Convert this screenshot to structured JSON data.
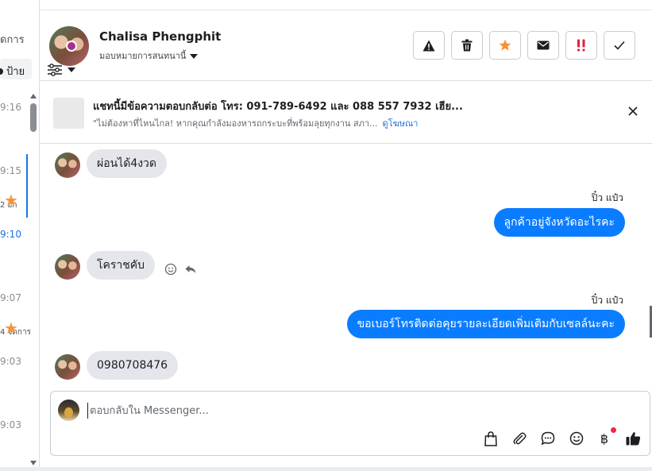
{
  "left_list": {
    "header_partial": "ัดการ",
    "tag_partial": "ป้าย",
    "times": [
      "9:16",
      "9:15",
      "9:10",
      "9:07",
      "9:03",
      "9:03"
    ],
    "snippets": [
      "2 ยก",
      "4 จัดการ"
    ]
  },
  "header": {
    "contact_name": "Chalisa Phengphit",
    "assign_label": "มอบหมายการสนทนานี้",
    "buttons": [
      {
        "name": "spam-button",
        "icon": "warning-icon"
      },
      {
        "name": "delete-button",
        "icon": "trash-icon"
      },
      {
        "name": "star-button",
        "icon": "star-icon"
      },
      {
        "name": "mark-unread-button",
        "icon": "envelope-icon"
      },
      {
        "name": "follow-up-button",
        "icon": "follow-up-icon"
      },
      {
        "name": "mark-done-button",
        "icon": "check-icon"
      }
    ]
  },
  "ad_banner": {
    "title": "แชทนี้มีข้อความตอบกลับต่อ โทร: 091-789-6492 และ 088 557 7932 เฮีย...",
    "subtitle": "\"ไม่ต้องหาที่ไหนไกล! หากคุณกำลังมองหารถกระบะที่พร้อมลุยทุกงาน สภา...",
    "link": "ดูโฆษณา"
  },
  "messages": [
    {
      "direction": "in",
      "text": "ผ่อนได้4งวด"
    },
    {
      "direction": "out",
      "sender": "ปิ๋ว แป๋ว",
      "text": "ลูกค้าอยู่จังหวัดอะไรคะ"
    },
    {
      "direction": "in",
      "text": "โคราชคับ"
    },
    {
      "direction": "out",
      "sender": "ปิ๋ว แป๋ว",
      "text": "ขอเบอร์โทรติดต่อคุยรายละเอียดเพิ่มเติมกับเซลล์นะคะ"
    },
    {
      "direction": "in",
      "text": "0980708476"
    }
  ],
  "composer": {
    "placeholder": "ตอบกลับใน Messenger...",
    "tools": [
      "bag-icon",
      "paperclip-icon",
      "saved-reply-icon",
      "emoji-icon",
      "baht-icon",
      "thumbs-up-icon"
    ],
    "baht_symbol": "฿"
  },
  "colors": {
    "outgoing_bubble": "#0a7cff",
    "incoming_bubble": "#e4e6eb",
    "star": "#f7923b",
    "follow_up": "#e41e3f",
    "link": "#216fdb"
  }
}
